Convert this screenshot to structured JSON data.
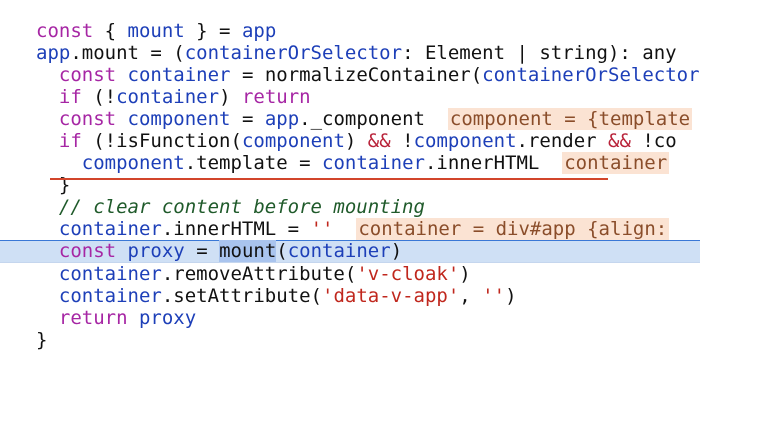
{
  "editor": {
    "lines": [
      {
        "kind": "plain",
        "segments": [
          {
            "t": "kw",
            "v": "const"
          },
          {
            "t": "plain",
            "v": " { "
          },
          {
            "t": "id",
            "v": "mount"
          },
          {
            "t": "plain",
            "v": " } = "
          },
          {
            "t": "id",
            "v": "app"
          }
        ]
      },
      {
        "kind": "plain",
        "segments": [
          {
            "t": "id",
            "v": "app"
          },
          {
            "t": "plain",
            "v": ".mount = ("
          },
          {
            "t": "id",
            "v": "containerOrSelector"
          },
          {
            "t": "plain",
            "v": ": Element | string): any"
          }
        ]
      },
      {
        "kind": "plain",
        "segments": [
          {
            "t": "plain",
            "v": "  "
          },
          {
            "t": "kw",
            "v": "const"
          },
          {
            "t": "plain",
            "v": " "
          },
          {
            "t": "id",
            "v": "container"
          },
          {
            "t": "plain",
            "v": " = normalizeContainer("
          },
          {
            "t": "id",
            "v": "containerOrSelector"
          },
          {
            "t": "plain",
            "v": ")"
          }
        ]
      },
      {
        "kind": "plain",
        "segments": [
          {
            "t": "plain",
            "v": "  "
          },
          {
            "t": "kw",
            "v": "if"
          },
          {
            "t": "plain",
            "v": " (!"
          },
          {
            "t": "id",
            "v": "container"
          },
          {
            "t": "plain",
            "v": ") "
          },
          {
            "t": "kw",
            "v": "return"
          }
        ]
      },
      {
        "kind": "plain",
        "segments": [
          {
            "t": "plain",
            "v": "  "
          },
          {
            "t": "kw",
            "v": "const"
          },
          {
            "t": "plain",
            "v": " "
          },
          {
            "t": "id",
            "v": "component"
          },
          {
            "t": "plain",
            "v": " = "
          },
          {
            "t": "id",
            "v": "app"
          },
          {
            "t": "plain",
            "v": "._component  "
          },
          {
            "t": "hint",
            "v": "component = {template"
          }
        ]
      },
      {
        "kind": "plain",
        "segments": [
          {
            "t": "plain",
            "v": "  "
          },
          {
            "t": "kw",
            "v": "if"
          },
          {
            "t": "plain",
            "v": " (!isFunction("
          },
          {
            "t": "id",
            "v": "component"
          },
          {
            "t": "plain",
            "v": ") "
          },
          {
            "t": "kw2",
            "v": "&&"
          },
          {
            "t": "plain",
            "v": " !"
          },
          {
            "t": "id",
            "v": "component"
          },
          {
            "t": "plain",
            "v": ".render "
          },
          {
            "t": "kw2",
            "v": "&&"
          },
          {
            "t": "plain",
            "v": " !co"
          }
        ]
      },
      {
        "kind": "plain",
        "segments": [
          {
            "t": "plain",
            "v": "    "
          },
          {
            "t": "id",
            "v": "component"
          },
          {
            "t": "plain",
            "v": ".template = "
          },
          {
            "t": "id",
            "v": "container"
          },
          {
            "t": "plain",
            "v": ".innerHTML  "
          },
          {
            "t": "hint",
            "v": "container"
          }
        ]
      },
      {
        "kind": "plain",
        "segments": [
          {
            "t": "plain",
            "v": "  }"
          }
        ]
      },
      {
        "kind": "plain",
        "segments": [
          {
            "t": "plain",
            "v": "  "
          },
          {
            "t": "cmt",
            "v": "// clear content before mounting"
          }
        ]
      },
      {
        "kind": "plain",
        "segments": [
          {
            "t": "plain",
            "v": "  "
          },
          {
            "t": "id",
            "v": "container"
          },
          {
            "t": "plain",
            "v": ".innerHTML = "
          },
          {
            "t": "str",
            "v": "''"
          },
          {
            "t": "plain",
            "v": "  "
          },
          {
            "t": "hint",
            "v": "container = div#app {align:"
          }
        ]
      },
      {
        "kind": "highlight",
        "segments": [
          {
            "t": "plain",
            "v": "  "
          },
          {
            "t": "kw",
            "v": "const"
          },
          {
            "t": "plain",
            "v": " "
          },
          {
            "t": "id",
            "v": "proxy"
          },
          {
            "t": "plain",
            "v": " = "
          },
          {
            "t": "sel",
            "v": "mount"
          },
          {
            "t": "plain",
            "v": "("
          },
          {
            "t": "id",
            "v": "container"
          },
          {
            "t": "plain",
            "v": ")"
          }
        ]
      },
      {
        "kind": "plain",
        "segments": [
          {
            "t": "plain",
            "v": "  "
          },
          {
            "t": "id",
            "v": "container"
          },
          {
            "t": "plain",
            "v": ".removeAttribute("
          },
          {
            "t": "str",
            "v": "'v-cloak'"
          },
          {
            "t": "plain",
            "v": ")"
          }
        ]
      },
      {
        "kind": "plain",
        "segments": [
          {
            "t": "plain",
            "v": "  "
          },
          {
            "t": "id",
            "v": "container"
          },
          {
            "t": "plain",
            "v": ".setAttribute("
          },
          {
            "t": "str",
            "v": "'data-v-app'"
          },
          {
            "t": "plain",
            "v": ", "
          },
          {
            "t": "str",
            "v": "''"
          },
          {
            "t": "plain",
            "v": ")"
          }
        ]
      },
      {
        "kind": "plain",
        "segments": [
          {
            "t": "plain",
            "v": "  "
          },
          {
            "t": "kw",
            "v": "return"
          },
          {
            "t": "plain",
            "v": " "
          },
          {
            "t": "id",
            "v": "proxy"
          }
        ]
      },
      {
        "kind": "plain",
        "segments": [
          {
            "t": "plain",
            "v": "}"
          }
        ]
      }
    ]
  },
  "colors": {
    "keyword": "#a626a4",
    "identifier": "#1d3fb8",
    "string": "#c0271d",
    "comment": "#1f5a2a",
    "hint_bg": "#fbe3d3",
    "current_line_bg": "#cfe0f5",
    "error_underline": "#d2452b"
  }
}
